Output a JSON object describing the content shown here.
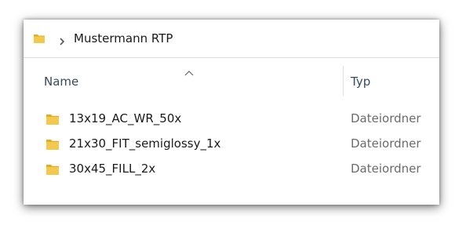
{
  "address": {
    "folder_icon": "folder-icon",
    "separator_icon": "chevron-right-icon",
    "path": "Mustermann RTP"
  },
  "header": {
    "sort_icon": "sort-ascending-icon",
    "name_label": "Name",
    "type_label": "Typ"
  },
  "files": [
    {
      "name": "13x19_AC_WR_50x",
      "type": "Dateiordner",
      "icon": "folder-icon"
    },
    {
      "name": "21x30_FIT_semiglossy_1x",
      "type": "Dateiordner",
      "icon": "folder-icon"
    },
    {
      "name": "30x45_FILL_2x",
      "type": "Dateiordner",
      "icon": "folder-icon"
    }
  ],
  "colors": {
    "folder_yellow": "#f2c94c",
    "folder_shade": "#e0ad2a",
    "header_text": "#3a4a5a",
    "type_text": "#6b6b6b"
  }
}
